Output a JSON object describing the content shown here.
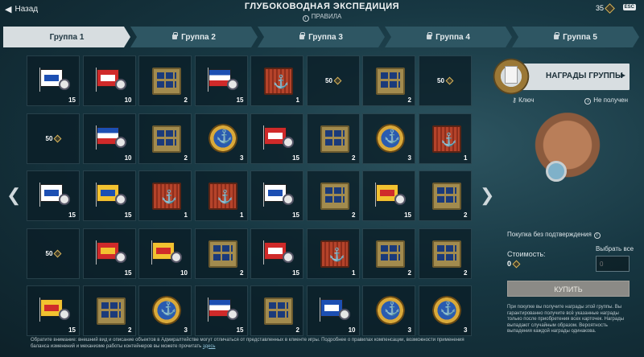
{
  "topbar": {
    "back_label": "Назад",
    "title": "ГЛУБОКОВОДНАЯ ЭКСПЕДИЦИЯ",
    "rules_label": "ПРАВИЛА",
    "balance": "35",
    "esc_label": "ESC"
  },
  "tabs": [
    {
      "label": "Группа 1",
      "active": true,
      "locked": false
    },
    {
      "label": "Группа 2",
      "active": false,
      "locked": true
    },
    {
      "label": "Группа 3",
      "active": false,
      "locked": true
    },
    {
      "label": "Группа 4",
      "active": false,
      "locked": true
    },
    {
      "label": "Группа 5",
      "active": false,
      "locked": true
    }
  ],
  "grid": [
    [
      {
        "kind": "flag",
        "colors": [
          "#ffffff",
          "#1c4fb3"
        ],
        "count": "15"
      },
      {
        "kind": "flag",
        "colors": [
          "#d02a2a",
          "#ffffff"
        ],
        "count": "10"
      },
      {
        "kind": "crate",
        "count": "2"
      },
      {
        "kind": "flag",
        "colors": [
          "#1c4fb3",
          "#ffffff",
          "#d02a2a"
        ],
        "count": "15"
      },
      {
        "kind": "redbox",
        "count": "1"
      },
      {
        "kind": "coins",
        "value": "50"
      },
      {
        "kind": "crate",
        "count": "2"
      },
      {
        "kind": "coins",
        "value": "50"
      }
    ],
    [
      {
        "kind": "coins",
        "value": "50"
      },
      {
        "kind": "flag",
        "colors": [
          "#1c4fb3",
          "#ffffff",
          "#d02a2a"
        ],
        "count": "10"
      },
      {
        "kind": "crate",
        "count": "2"
      },
      {
        "kind": "medal",
        "count": "3"
      },
      {
        "kind": "flag",
        "colors": [
          "#d02a2a",
          "#ffffff"
        ],
        "count": "15"
      },
      {
        "kind": "crate",
        "count": "2"
      },
      {
        "kind": "medal",
        "count": "3"
      },
      {
        "kind": "redbox",
        "count": "1"
      }
    ],
    [
      {
        "kind": "flag",
        "colors": [
          "#ffffff",
          "#1c4fb3"
        ],
        "count": "15"
      },
      {
        "kind": "flag",
        "colors": [
          "#f2c230",
          "#1c4fb3"
        ],
        "count": "15"
      },
      {
        "kind": "redbox",
        "count": "1"
      },
      {
        "kind": "redbox",
        "count": "1"
      },
      {
        "kind": "flag",
        "colors": [
          "#ffffff",
          "#1c4fb3"
        ],
        "count": "15"
      },
      {
        "kind": "crate",
        "count": "2"
      },
      {
        "kind": "flag",
        "colors": [
          "#f2c230",
          "#d02a2a"
        ],
        "count": "15"
      },
      {
        "kind": "crate",
        "count": "2"
      }
    ],
    [
      {
        "kind": "coins",
        "value": "50"
      },
      {
        "kind": "flag",
        "colors": [
          "#d02a2a",
          "#f2c230"
        ],
        "count": "15"
      },
      {
        "kind": "flag",
        "colors": [
          "#f2c230",
          "#d02a2a"
        ],
        "count": "10"
      },
      {
        "kind": "crate",
        "count": "2"
      },
      {
        "kind": "flag",
        "colors": [
          "#d02a2a",
          "#ffffff"
        ],
        "count": "15"
      },
      {
        "kind": "redbox",
        "count": "1"
      },
      {
        "kind": "crate",
        "count": "2"
      },
      {
        "kind": "crate",
        "count": "2"
      }
    ],
    [
      {
        "kind": "flag",
        "colors": [
          "#f2c230",
          "#d02a2a"
        ],
        "count": "15"
      },
      {
        "kind": "crate",
        "count": "2"
      },
      {
        "kind": "medal",
        "count": "3"
      },
      {
        "kind": "flag",
        "colors": [
          "#1c4fb3",
          "#ffffff",
          "#d02a2a"
        ],
        "count": "15"
      },
      {
        "kind": "crate",
        "count": "2"
      },
      {
        "kind": "flag",
        "colors": [
          "#1c4fb3",
          "#ffffff"
        ],
        "count": "10"
      },
      {
        "kind": "medal",
        "count": "3"
      },
      {
        "kind": "medal",
        "count": "3"
      }
    ]
  ],
  "panel": {
    "rewards_label": "НАГРАДЫ ГРУППЫ",
    "key_label": "Ключ",
    "status_label": "Не получен",
    "autobuy_label": "Покупка без подтверждения",
    "select_label": "Выбрать все",
    "qty_placeholder": "0",
    "cost_label": "Стоимость:",
    "cost_value": "0",
    "buy_label": "КУПИТЬ",
    "note": "При покупке вы получите награды этой группы. Вы гарантированно получите всё указанные награды только после приобретения всех карточек. Награды выпадают случайным образом. Вероятность выпадения каждой награды одинакова."
  },
  "footnote": {
    "text": "Обратите внимание: внешний вид и описание объектов в Адмиралтействе могут отличаться от представленных в клиенте игры. Подробнее о правилах компенсации, возможности применения баланса изменений и механизме работы контейнеров вы можете прочитать",
    "link": "здесь"
  }
}
